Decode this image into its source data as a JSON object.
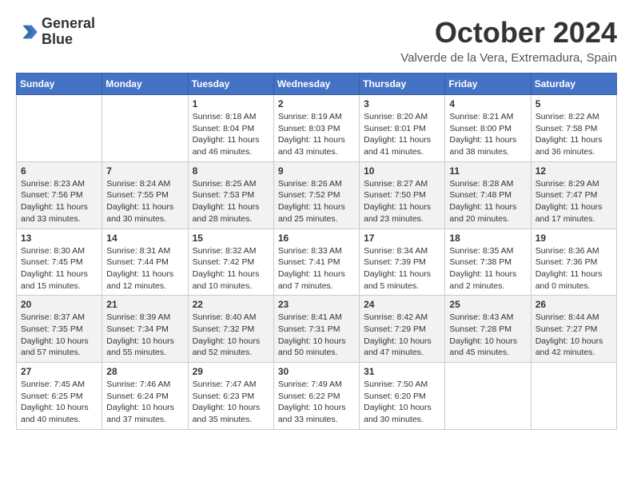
{
  "header": {
    "logo_line1": "General",
    "logo_line2": "Blue",
    "month": "October 2024",
    "location": "Valverde de la Vera, Extremadura, Spain"
  },
  "days_of_week": [
    "Sunday",
    "Monday",
    "Tuesday",
    "Wednesday",
    "Thursday",
    "Friday",
    "Saturday"
  ],
  "weeks": [
    [
      {
        "day": "",
        "info": ""
      },
      {
        "day": "",
        "info": ""
      },
      {
        "day": "1",
        "info": "Sunrise: 8:18 AM\nSunset: 8:04 PM\nDaylight: 11 hours and 46 minutes."
      },
      {
        "day": "2",
        "info": "Sunrise: 8:19 AM\nSunset: 8:03 PM\nDaylight: 11 hours and 43 minutes."
      },
      {
        "day": "3",
        "info": "Sunrise: 8:20 AM\nSunset: 8:01 PM\nDaylight: 11 hours and 41 minutes."
      },
      {
        "day": "4",
        "info": "Sunrise: 8:21 AM\nSunset: 8:00 PM\nDaylight: 11 hours and 38 minutes."
      },
      {
        "day": "5",
        "info": "Sunrise: 8:22 AM\nSunset: 7:58 PM\nDaylight: 11 hours and 36 minutes."
      }
    ],
    [
      {
        "day": "6",
        "info": "Sunrise: 8:23 AM\nSunset: 7:56 PM\nDaylight: 11 hours and 33 minutes."
      },
      {
        "day": "7",
        "info": "Sunrise: 8:24 AM\nSunset: 7:55 PM\nDaylight: 11 hours and 30 minutes."
      },
      {
        "day": "8",
        "info": "Sunrise: 8:25 AM\nSunset: 7:53 PM\nDaylight: 11 hours and 28 minutes."
      },
      {
        "day": "9",
        "info": "Sunrise: 8:26 AM\nSunset: 7:52 PM\nDaylight: 11 hours and 25 minutes."
      },
      {
        "day": "10",
        "info": "Sunrise: 8:27 AM\nSunset: 7:50 PM\nDaylight: 11 hours and 23 minutes."
      },
      {
        "day": "11",
        "info": "Sunrise: 8:28 AM\nSunset: 7:48 PM\nDaylight: 11 hours and 20 minutes."
      },
      {
        "day": "12",
        "info": "Sunrise: 8:29 AM\nSunset: 7:47 PM\nDaylight: 11 hours and 17 minutes."
      }
    ],
    [
      {
        "day": "13",
        "info": "Sunrise: 8:30 AM\nSunset: 7:45 PM\nDaylight: 11 hours and 15 minutes."
      },
      {
        "day": "14",
        "info": "Sunrise: 8:31 AM\nSunset: 7:44 PM\nDaylight: 11 hours and 12 minutes."
      },
      {
        "day": "15",
        "info": "Sunrise: 8:32 AM\nSunset: 7:42 PM\nDaylight: 11 hours and 10 minutes."
      },
      {
        "day": "16",
        "info": "Sunrise: 8:33 AM\nSunset: 7:41 PM\nDaylight: 11 hours and 7 minutes."
      },
      {
        "day": "17",
        "info": "Sunrise: 8:34 AM\nSunset: 7:39 PM\nDaylight: 11 hours and 5 minutes."
      },
      {
        "day": "18",
        "info": "Sunrise: 8:35 AM\nSunset: 7:38 PM\nDaylight: 11 hours and 2 minutes."
      },
      {
        "day": "19",
        "info": "Sunrise: 8:36 AM\nSunset: 7:36 PM\nDaylight: 11 hours and 0 minutes."
      }
    ],
    [
      {
        "day": "20",
        "info": "Sunrise: 8:37 AM\nSunset: 7:35 PM\nDaylight: 10 hours and 57 minutes."
      },
      {
        "day": "21",
        "info": "Sunrise: 8:39 AM\nSunset: 7:34 PM\nDaylight: 10 hours and 55 minutes."
      },
      {
        "day": "22",
        "info": "Sunrise: 8:40 AM\nSunset: 7:32 PM\nDaylight: 10 hours and 52 minutes."
      },
      {
        "day": "23",
        "info": "Sunrise: 8:41 AM\nSunset: 7:31 PM\nDaylight: 10 hours and 50 minutes."
      },
      {
        "day": "24",
        "info": "Sunrise: 8:42 AM\nSunset: 7:29 PM\nDaylight: 10 hours and 47 minutes."
      },
      {
        "day": "25",
        "info": "Sunrise: 8:43 AM\nSunset: 7:28 PM\nDaylight: 10 hours and 45 minutes."
      },
      {
        "day": "26",
        "info": "Sunrise: 8:44 AM\nSunset: 7:27 PM\nDaylight: 10 hours and 42 minutes."
      }
    ],
    [
      {
        "day": "27",
        "info": "Sunrise: 7:45 AM\nSunset: 6:25 PM\nDaylight: 10 hours and 40 minutes."
      },
      {
        "day": "28",
        "info": "Sunrise: 7:46 AM\nSunset: 6:24 PM\nDaylight: 10 hours and 37 minutes."
      },
      {
        "day": "29",
        "info": "Sunrise: 7:47 AM\nSunset: 6:23 PM\nDaylight: 10 hours and 35 minutes."
      },
      {
        "day": "30",
        "info": "Sunrise: 7:49 AM\nSunset: 6:22 PM\nDaylight: 10 hours and 33 minutes."
      },
      {
        "day": "31",
        "info": "Sunrise: 7:50 AM\nSunset: 6:20 PM\nDaylight: 10 hours and 30 minutes."
      },
      {
        "day": "",
        "info": ""
      },
      {
        "day": "",
        "info": ""
      }
    ]
  ]
}
